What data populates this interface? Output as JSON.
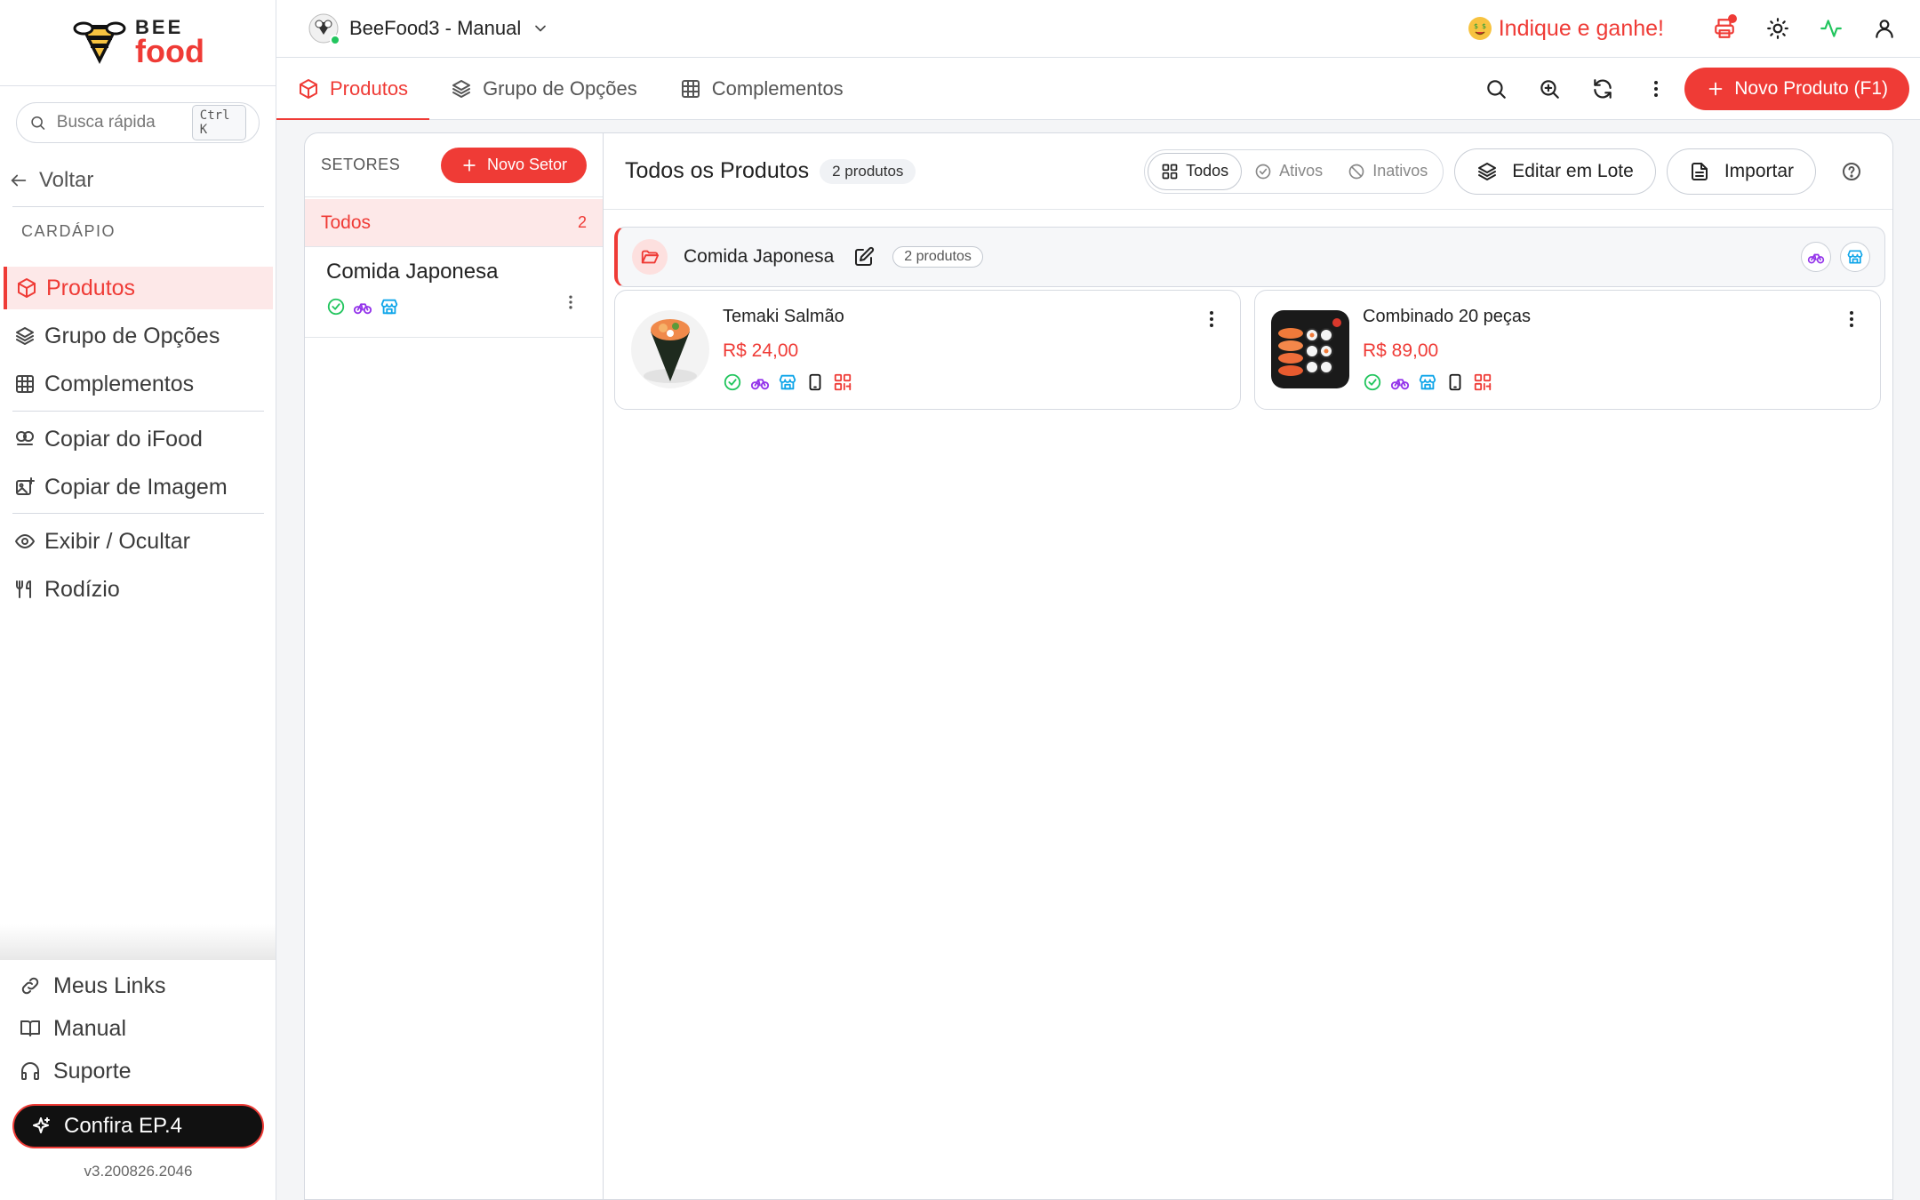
{
  "app": {
    "logo_top": "BEE",
    "logo_bottom": "food",
    "version": "v3.200826.2046"
  },
  "colors": {
    "accent": "#ef3b36",
    "success": "#22c55e",
    "delivery": "#9333ea",
    "store": "#0ea5e9"
  },
  "sidebar": {
    "search_placeholder": "Busca rápida",
    "search_shortcut": "Ctrl K",
    "back_label": "Voltar",
    "section_title": "CARDÁPIO",
    "items": [
      {
        "label": "Produtos",
        "icon": "box-icon",
        "active": true
      },
      {
        "label": "Grupo de Opções",
        "icon": "layers-icon"
      },
      {
        "label": "Complementos",
        "icon": "grid-icon"
      },
      {
        "label": "Copiar do iFood",
        "icon": "copy-icon"
      },
      {
        "label": "Copiar de Imagem",
        "icon": "image-plus-icon"
      },
      {
        "label": "Exibir / Ocultar",
        "icon": "eye-icon"
      },
      {
        "label": "Rodízio",
        "icon": "utensils-icon"
      }
    ],
    "bottom": [
      {
        "label": "Meus Links",
        "icon": "link-icon"
      },
      {
        "label": "Manual",
        "icon": "book-icon"
      },
      {
        "label": "Suporte",
        "icon": "headset-icon"
      }
    ],
    "cta_label": "Confira EP.4"
  },
  "header": {
    "store_name": "BeeFood3 - Manual",
    "indique_label": "Indique e ganhe!",
    "icons": [
      "printer-icon",
      "sun-icon",
      "activity-icon",
      "user-icon"
    ]
  },
  "tabs": [
    {
      "label": "Produtos",
      "icon": "box-icon",
      "active": true
    },
    {
      "label": "Grupo de Opções",
      "icon": "layers-icon"
    },
    {
      "label": "Complementos",
      "icon": "grid-icon"
    }
  ],
  "toolbar": {
    "new_product_label": "Novo Produto (F1)"
  },
  "sectors": {
    "header_label": "SETORES",
    "new_sector_label": "Novo Setor",
    "all_label": "Todos",
    "all_count": "2",
    "list": [
      {
        "name": "Comida Japonesa"
      }
    ]
  },
  "products": {
    "title": "Todos os Produtos",
    "count_label": "2 produtos",
    "filters": [
      {
        "label": "Todos",
        "icon": "grid-icon",
        "selected": true
      },
      {
        "label": "Ativos",
        "icon": "check-circle-icon"
      },
      {
        "label": "Inativos",
        "icon": "ban-icon"
      }
    ],
    "batch_edit_label": "Editar em Lote",
    "import_label": "Importar",
    "group": {
      "name": "Comida Japonesa",
      "count_label": "2 produtos"
    },
    "items": [
      {
        "name": "Temaki Salmão",
        "price": "R$ 24,00"
      },
      {
        "name": "Combinado 20 peças",
        "price": "R$ 89,00"
      }
    ]
  }
}
